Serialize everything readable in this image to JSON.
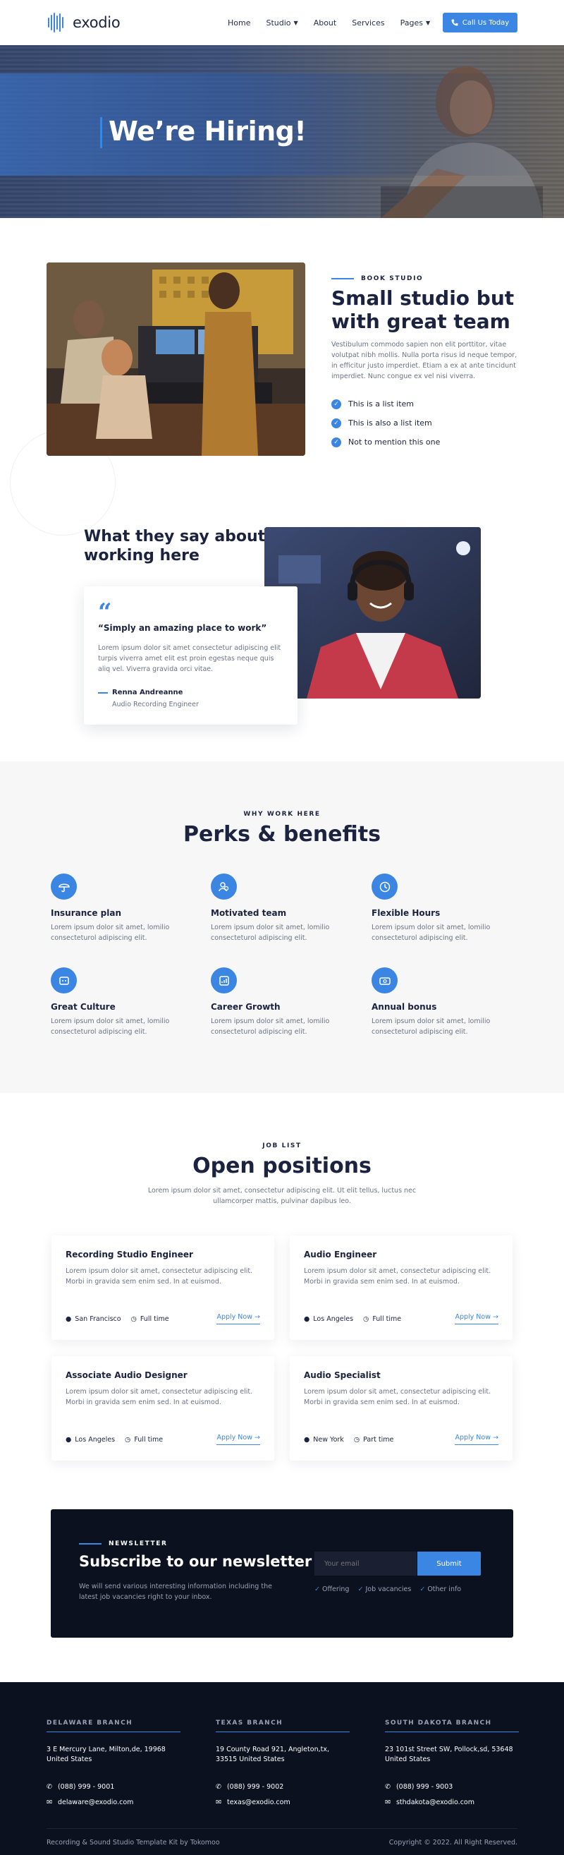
{
  "header": {
    "logo_text": "exodio",
    "nav": [
      {
        "label": "Home",
        "dropdown": false
      },
      {
        "label": "Studio",
        "dropdown": true
      },
      {
        "label": "About",
        "dropdown": false
      },
      {
        "label": "Services",
        "dropdown": false
      },
      {
        "label": "Pages",
        "dropdown": true
      }
    ],
    "cta_label": "Call Us Today",
    "cta_icon": "phone-icon"
  },
  "hero": {
    "title": "We’re Hiring!"
  },
  "studio": {
    "eyebrow": "BOOK STUDIO",
    "title": "Small studio but with great team",
    "text": "Vestibulum commodo sapien non elit porttitor, vitae volutpat nibh mollis. Nulla porta risus id neque tempor, in efficitur justo imperdiet. Etiam a ex at ante tincidunt imperdiet. Nunc congue ex vel nisi viverra.",
    "checks": [
      "This is a list item",
      "This is also a list item",
      "Not to mention this one"
    ]
  },
  "testimonial": {
    "title": "What they say about working here",
    "quote_title": "“Simply an amazing place to work”",
    "quote_text": "Lorem ipsum dolor sit amet consectetur adipiscing elit turpis viverra amet elit est proin egestas neque quis aliq vel. Viverra gravida orci vitae.",
    "name": "Renna Andreanne",
    "role": "Audio Recording Engineer"
  },
  "perks": {
    "eyebrow": "WHY WORK HERE",
    "title": "Perks & benefits",
    "items": [
      {
        "title": "Insurance plan",
        "text": "Lorem ipsum dolor sit amet, lomilio consecteturol adipiscing elit.",
        "icon": "umbrella-icon"
      },
      {
        "title": "Motivated team",
        "text": "Lorem ipsum dolor sit amet, lomilio consecteturol adipiscing elit.",
        "icon": "team-icon"
      },
      {
        "title": "Flexible Hours",
        "text": "Lorem ipsum dolor sit amet, lomilio consecteturol adipiscing elit.",
        "icon": "clock-icon"
      },
      {
        "title": "Great Culture",
        "text": "Lorem ipsum dolor sit amet, lomilio consecteturol adipiscing elit.",
        "icon": "culture-icon"
      },
      {
        "title": "Career Growth",
        "text": "Lorem ipsum dolor sit amet, lomilio consecteturol adipiscing elit.",
        "icon": "growth-chart-icon"
      },
      {
        "title": "Annual bonus",
        "text": "Lorem ipsum dolor sit amet, lomilio consecteturol adipiscing elit.",
        "icon": "bonus-icon"
      }
    ]
  },
  "jobs": {
    "eyebrow": "JOB LIST",
    "title": "Open positions",
    "subtitle": "Lorem ipsum dolor sit amet, consectetur adipiscing elit. Ut elit tellus, luctus nec ullamcorper mattis, pulvinar dapibus leo.",
    "apply_label": "Apply Now",
    "items": [
      {
        "title": "Recording Studio Engineer",
        "text": "Lorem ipsum dolor sit amet, consectetur adipiscing elit. Morbi in gravida sem enim sed. In at euismod.",
        "location": "San Francisco",
        "type": "Full time"
      },
      {
        "title": "Audio Engineer",
        "text": "Lorem ipsum dolor sit amet, consectetur adipiscing elit. Morbi in gravida sem enim sed. In at euismod.",
        "location": "Los Angeles",
        "type": "Full time"
      },
      {
        "title": "Associate Audio Designer",
        "text": "Lorem ipsum dolor sit amet, consectetur adipiscing elit. Morbi in gravida sem enim sed. In at euismod.",
        "location": "Los Angeles",
        "type": "Full time"
      },
      {
        "title": "Audio Specialist",
        "text": "Lorem ipsum dolor sit amet, consectetur adipiscing elit. Morbi in gravida sem enim sed. In at euismod.",
        "location": "New York",
        "type": "Part time"
      }
    ]
  },
  "newsletter": {
    "eyebrow": "NEWSLETTER",
    "title": "Subscribe to our newsletter",
    "text": "We will send various interesting information including the latest job vacancies right to your inbox.",
    "placeholder": "Your email",
    "button": "Submit",
    "tags": [
      "Offering",
      "Job vacancies",
      "Other info"
    ]
  },
  "footer": {
    "branches": [
      {
        "name": "DELAWARE BRANCH",
        "address": "3 E Mercury Lane, Milton,de, 19968 United States",
        "phone": "(088) 999 - 9001",
        "email": "delaware@exodio.com"
      },
      {
        "name": "TEXAS BRANCH",
        "address": "19 County Road 921, Angleton,tx, 33515 United States",
        "phone": "(088) 999 - 9002",
        "email": "texas@exodio.com"
      },
      {
        "name": "SOUTH DAKOTA BRANCH",
        "address": "23 101st Street SW, Pollock,sd, 53648 United States",
        "phone": "(088) 999 - 9003",
        "email": "sthdakota@exodio.com"
      }
    ],
    "left": "Recording & Sound Studio Template Kit by Tokomoo",
    "right": "Copyright © 2022. All Right Reserved."
  },
  "colors": {
    "accent": "#3b86e3",
    "dark": "#0c1120",
    "heading": "#1b2340"
  }
}
